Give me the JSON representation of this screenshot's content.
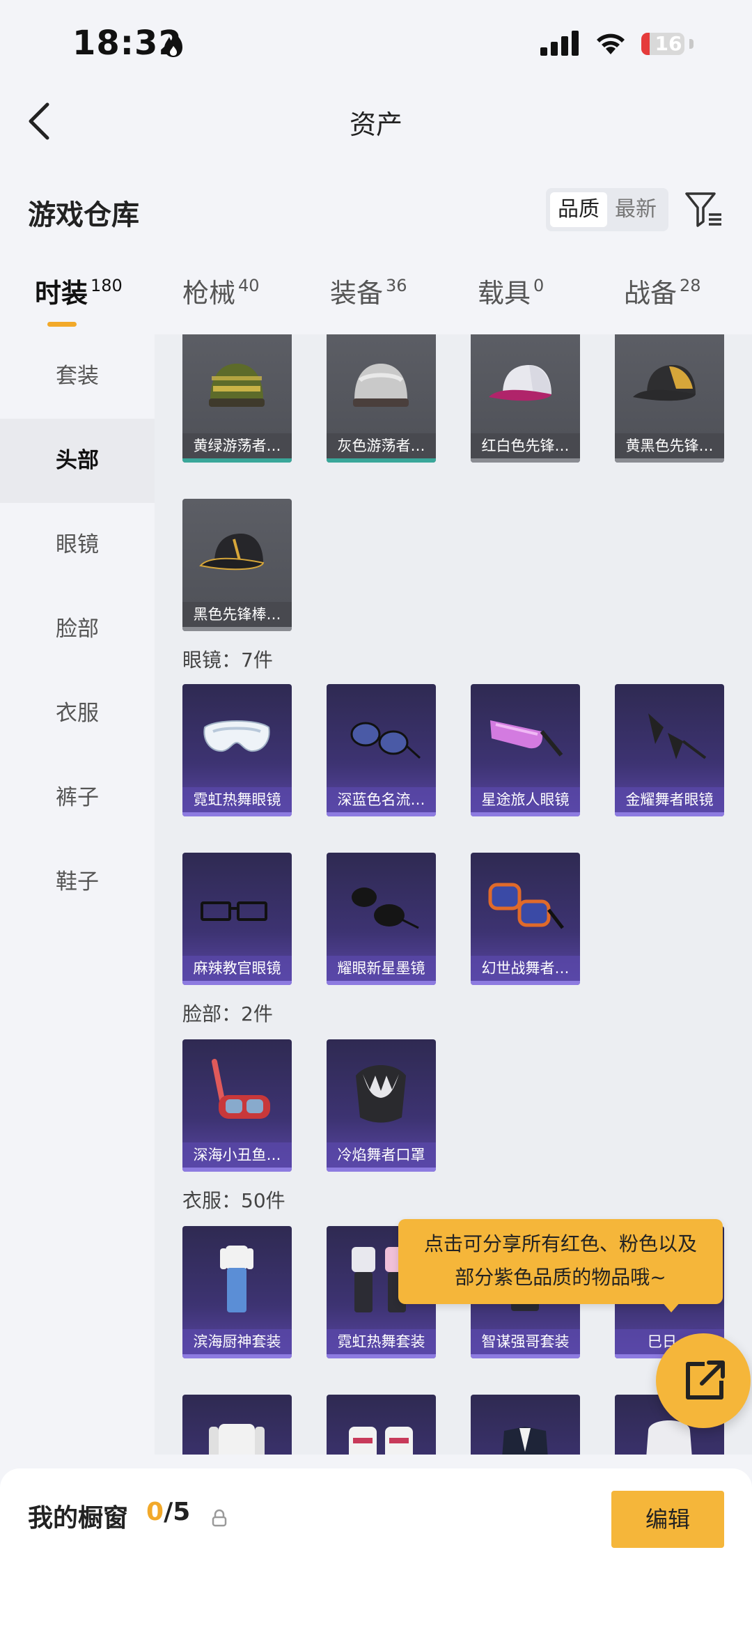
{
  "status": {
    "time": "18:32",
    "battery": "16"
  },
  "nav": {
    "title": "资产"
  },
  "warehouse": {
    "title": "游戏仓库",
    "sort_options": [
      "品质",
      "最新"
    ],
    "active_sort": "品质"
  },
  "tabs": [
    {
      "label": "时装",
      "count": "180"
    },
    {
      "label": "枪械",
      "count": "40"
    },
    {
      "label": "装备",
      "count": "36"
    },
    {
      "label": "载具",
      "count": "0"
    },
    {
      "label": "战备",
      "count": "28"
    }
  ],
  "sidebar": {
    "items": [
      "套装",
      "头部",
      "眼镜",
      "脸部",
      "衣服",
      "裤子",
      "鞋子"
    ],
    "active": "头部"
  },
  "head_items": [
    "黄绿游荡者…",
    "灰色游荡者…",
    "红白色先锋…",
    "黄黑色先锋…",
    "黑色先锋棒…"
  ],
  "glasses_section": "眼镜：7件",
  "glasses_items": [
    "霓虹热舞眼镜",
    "深蓝色名流…",
    "星途旅人眼镜",
    "金耀舞者眼镜",
    "麻辣教官眼镜",
    "耀眼新星墨镜",
    "幻世战舞者…"
  ],
  "face_section": "脸部：2件",
  "face_items": [
    "深海小丑鱼…",
    "冷焰舞者口罩"
  ],
  "clothes_section": "衣服：50件",
  "clothes_items": [
    "滨海厨神套装",
    "霓虹热舞套装",
    "智谋强哥套装",
    "巳日…"
  ],
  "tooltip": {
    "line1": "点击可分享所有红色、粉色以及",
    "line2": "部分紫色品质的物品哦~"
  },
  "showcase": {
    "title": "我的橱窗",
    "current": "0",
    "sep": "/",
    "max": "5",
    "edit_label": "编辑"
  },
  "colors": {
    "accent": "#f5b63a",
    "rare_purple": "#3d3372",
    "common_grey": "#55575e"
  }
}
